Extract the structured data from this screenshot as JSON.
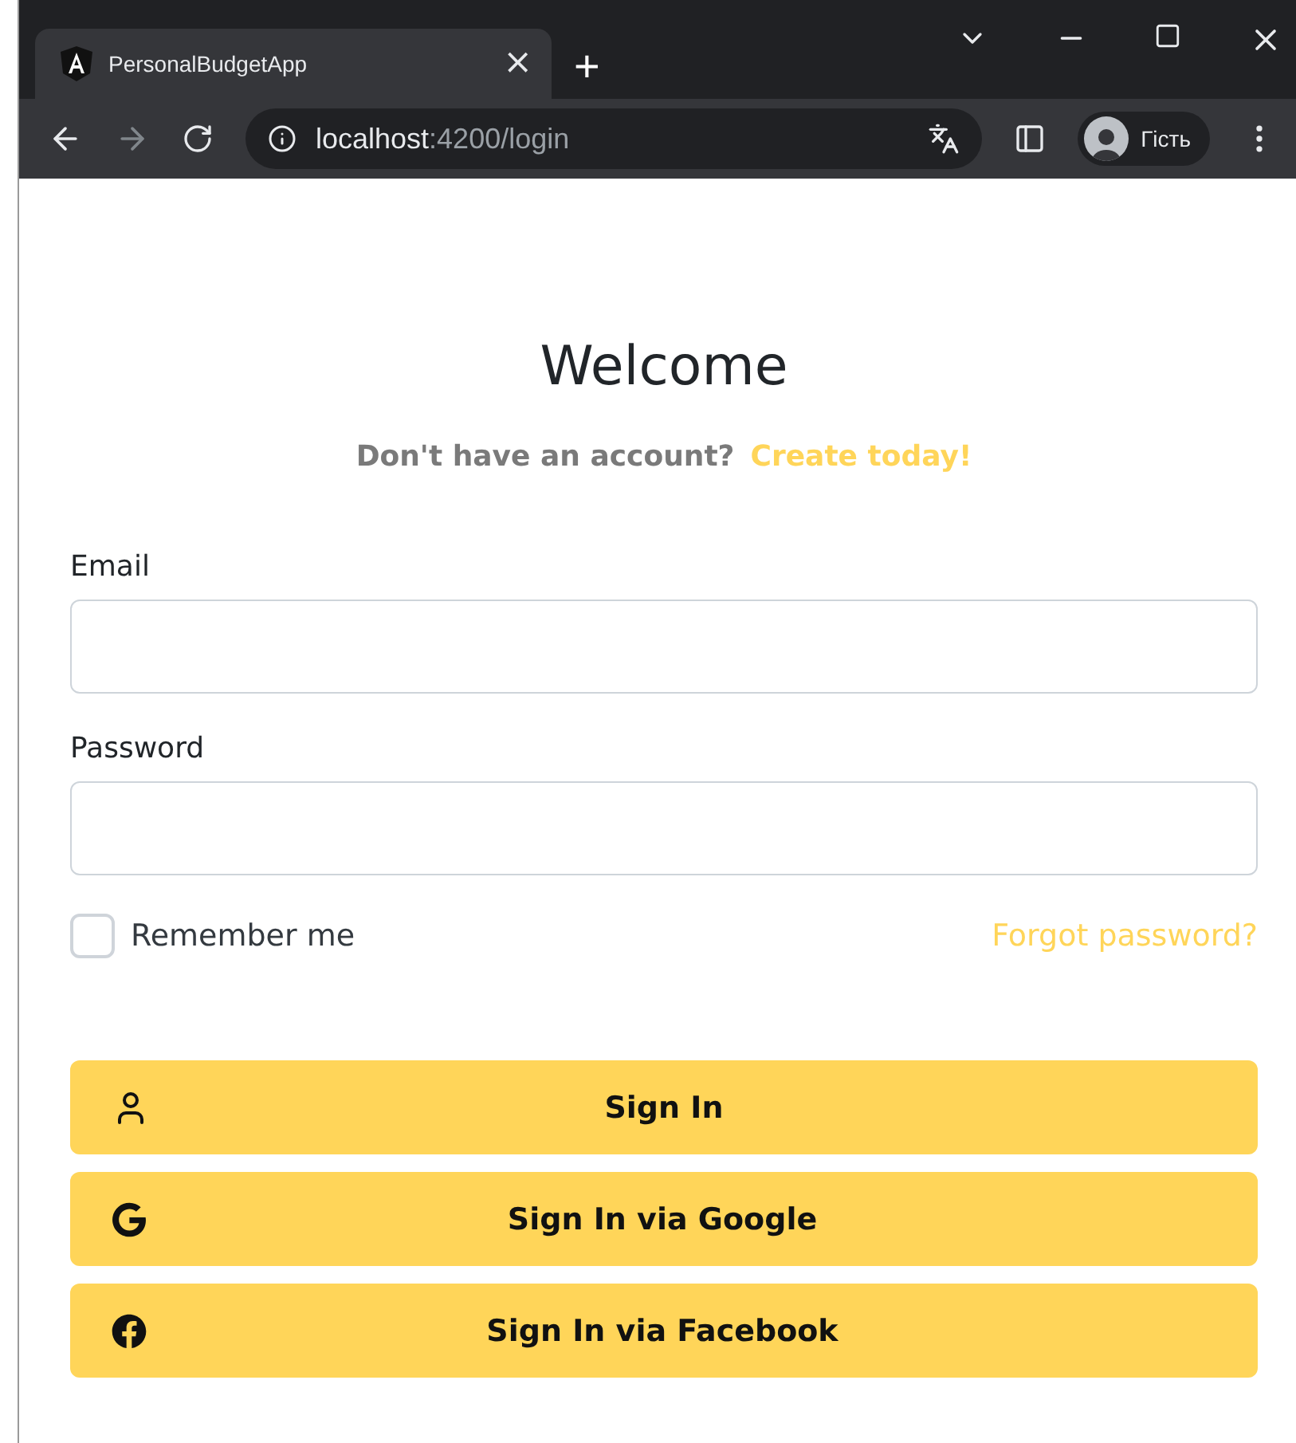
{
  "browser": {
    "tab": {
      "title": "PersonalBudgetApp",
      "close": "×"
    },
    "new_tab": "+",
    "address": {
      "host": "localhost",
      "path": ":4200/login"
    },
    "profile": "Гість"
  },
  "page": {
    "title": "Welcome",
    "prompt": "Don't have an account?",
    "signup_link": "Create today!",
    "fields": [
      {
        "label": "Email"
      },
      {
        "label": "Password"
      }
    ],
    "remember": {
      "label": "Remember me",
      "checked": false
    },
    "forgot_link": "Forgot password?",
    "buttons": [
      {
        "kind": "user",
        "label": "Sign In"
      },
      {
        "kind": "google",
        "label": "Sign In via Google"
      },
      {
        "kind": "facebook",
        "label": "Sign In via Facebook"
      }
    ]
  }
}
